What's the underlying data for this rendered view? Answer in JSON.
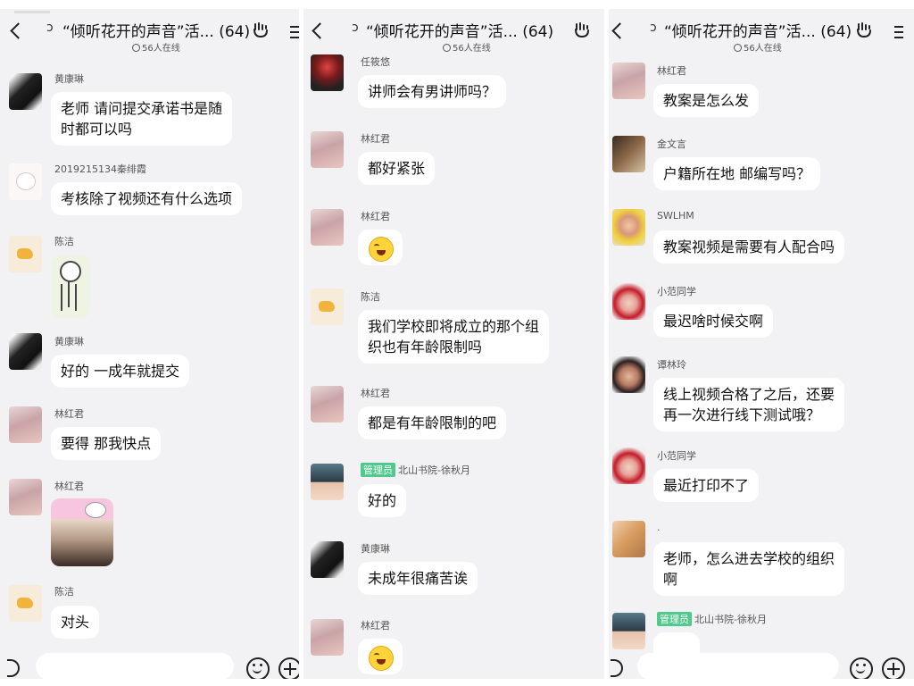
{
  "header": {
    "title": "“倾听花开的声音”活... (64)",
    "online": "56人在线"
  },
  "panels": [
    {
      "messages": [
        {
          "sender": "黄康琳",
          "text": "老师 请问提交承诺书是随\n时都可以吗"
        },
        {
          "sender": "2019215134秦绯霞",
          "text": "考核除了视频还有什么选项"
        },
        {
          "sender": "陈洁",
          "text": ""
        },
        {
          "sender": "黄康琳",
          "text": "好的 一成年就提交"
        },
        {
          "sender": "林红君",
          "text": "要得 那我快点"
        },
        {
          "sender": "林红君",
          "text": ""
        },
        {
          "sender": "陈洁",
          "text": "对头"
        }
      ]
    },
    {
      "messages": [
        {
          "sender": "任筱悠",
          "text": "讲师会有男讲师吗？"
        },
        {
          "sender": "林红君",
          "text": "都好紧张"
        },
        {
          "sender": "林红君",
          "text": ""
        },
        {
          "sender": "陈洁",
          "text": "我们学校即将成立的那个组\n织也有年龄限制吗"
        },
        {
          "sender": "林红君",
          "text": "都是有年龄限制的吧"
        },
        {
          "sender": "北山书院-徐秋月",
          "badge": "管理员",
          "text": "好的"
        },
        {
          "sender": "黄康琳",
          "text": "未成年很痛苦诶"
        },
        {
          "sender": "林红君",
          "text": ""
        }
      ]
    },
    {
      "messages": [
        {
          "sender": "林红君",
          "text": "教案是怎么发"
        },
        {
          "sender": "金文言",
          "text": "户籍所在地 邮编写吗？"
        },
        {
          "sender": "SWLHM",
          "text": "教案视频是需要有人配合吗"
        },
        {
          "sender": "小范同学",
          "text": "最迟啥时候交啊"
        },
        {
          "sender": "谭林玲",
          "text": "线上视频合格了之后，还要\n再一次进行线下测试哦？"
        },
        {
          "sender": "小范同学",
          "text": "最近打印不了"
        },
        {
          "sender": ".",
          "text": "老师，怎么进去学校的组织\n啊"
        },
        {
          "sender": "北山书院-徐秋月",
          "badge": "管理员",
          "text": ""
        }
      ]
    }
  ],
  "icons": {
    "back": "chevron-left-icon",
    "ear": "ear-icon",
    "hand": "rock-hand-icon",
    "menu": "menu-icon",
    "online": "online-status-icon",
    "emoji": "laugh-cry-emoji-icon",
    "smile": "emoji-button-icon",
    "plus": "plus-icon",
    "voice": "voice-icon"
  }
}
